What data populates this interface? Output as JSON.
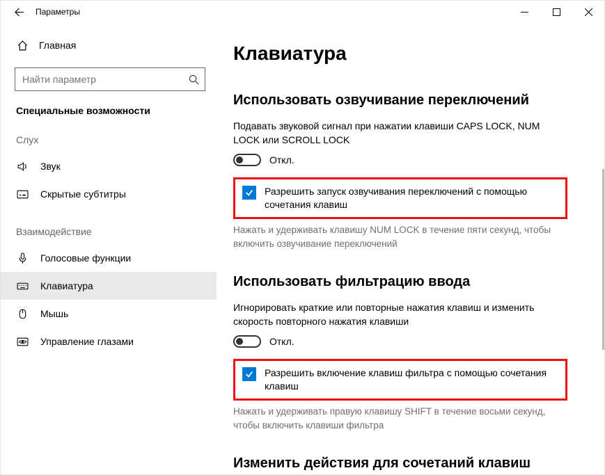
{
  "titlebar": {
    "title": "Параметры"
  },
  "sidebar": {
    "home": "Главная",
    "search_placeholder": "Найти параметр",
    "section": "Специальные возможности",
    "group_hearing": "Слух",
    "group_interaction": "Взаимодействие",
    "items": {
      "sound": "Звук",
      "captions": "Скрытые субтитры",
      "speech": "Голосовые функции",
      "keyboard": "Клавиатура",
      "mouse": "Мышь",
      "eye": "Управление глазами"
    }
  },
  "main": {
    "title": "Клавиатура",
    "toggle_keys": {
      "heading": "Использовать озвучивание переключений",
      "desc": "Подавать звуковой сигнал при нажатии клавиши CAPS LOCK, NUM LOCK или SCROLL LOCK",
      "state": "Откл.",
      "chk_label": "Разрешить запуск озвучивания переключений с помощью сочетания клавиш",
      "hint": "Нажать и удерживать клавишу NUM LOCK в течение пяти секунд, чтобы включить озвучивание переключений"
    },
    "filter_keys": {
      "heading": "Использовать фильтрацию ввода",
      "desc": "Игнорировать краткие или повторные нажатия клавиш и изменить скорость повторного нажатия клавиши",
      "state": "Откл.",
      "chk_label": "Разрешить включение клавиш фильтра с помощью сочетания клавиш",
      "hint": "Нажать и удерживать правую клавишу SHIFT в течение восьми секунд, чтобы включить клавиши фильтра"
    },
    "shortcuts": {
      "heading": "Изменить действия для сочетаний клавиш"
    }
  }
}
